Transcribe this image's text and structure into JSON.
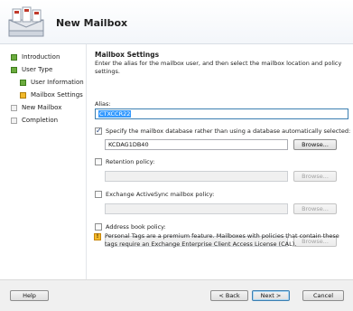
{
  "header": {
    "title": "New Mailbox",
    "icon": "mailbox-wizard-icon"
  },
  "sidebar": {
    "items": [
      {
        "label": "Introduction",
        "state": "done"
      },
      {
        "label": "User Type",
        "state": "done"
      },
      {
        "label": "User Information",
        "state": "done"
      },
      {
        "label": "Mailbox Settings",
        "state": "current"
      },
      {
        "label": "New Mailbox",
        "state": "pending"
      },
      {
        "label": "Completion",
        "state": "pending"
      }
    ]
  },
  "main": {
    "section_title": "Mailbox Settings",
    "description": "Enter the alias for the mailbox user, and then select the mailbox location and policy settings.",
    "alias": {
      "label": "Alias:",
      "value": "CTXCCR22"
    },
    "database": {
      "checkbox_label": "Specify the mailbox database rather than using a database automatically selected:",
      "checked": true,
      "value": "KCDAG1DB40",
      "browse_label": "Browse..."
    },
    "retention": {
      "checkbox_label": "Retention policy:",
      "checked": false,
      "value": "",
      "browse_label": "Browse..."
    },
    "activesync": {
      "checkbox_label": "Exchange ActiveSync mailbox policy:",
      "checked": false,
      "value": "",
      "browse_label": "Browse..."
    },
    "addressbook": {
      "checkbox_label": "Address book policy:",
      "checked": false,
      "value": "",
      "browse_label": "Browse..."
    },
    "note": "Personal Tags are a premium feature. Mailboxes with policies that contain these tags require an Exchange Enterprise Client Access License (CAL)."
  },
  "footer": {
    "help_label": "Help",
    "back_label": "< Back",
    "next_label": "Next >",
    "cancel_label": "Cancel"
  },
  "colors": {
    "done": "#6bab3e",
    "current": "#f2b92b",
    "pending": "#f2f2f2",
    "selection": "#3399ff"
  }
}
